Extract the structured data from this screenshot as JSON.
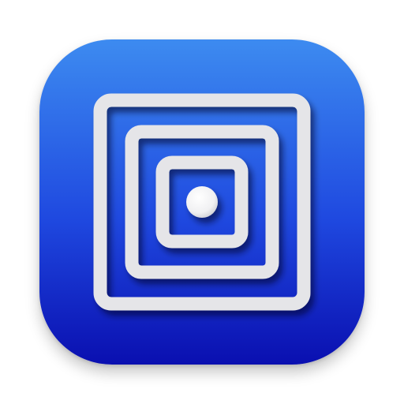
{
  "icon": {
    "name": "concentric-squares-app-icon",
    "colors": {
      "background_top": "#3d8bf0",
      "background_bottom": "#0a0fb0",
      "frame": "#e5e5e8",
      "frame_highlight": "#f5f5f7",
      "dot": "#ffffff"
    }
  }
}
